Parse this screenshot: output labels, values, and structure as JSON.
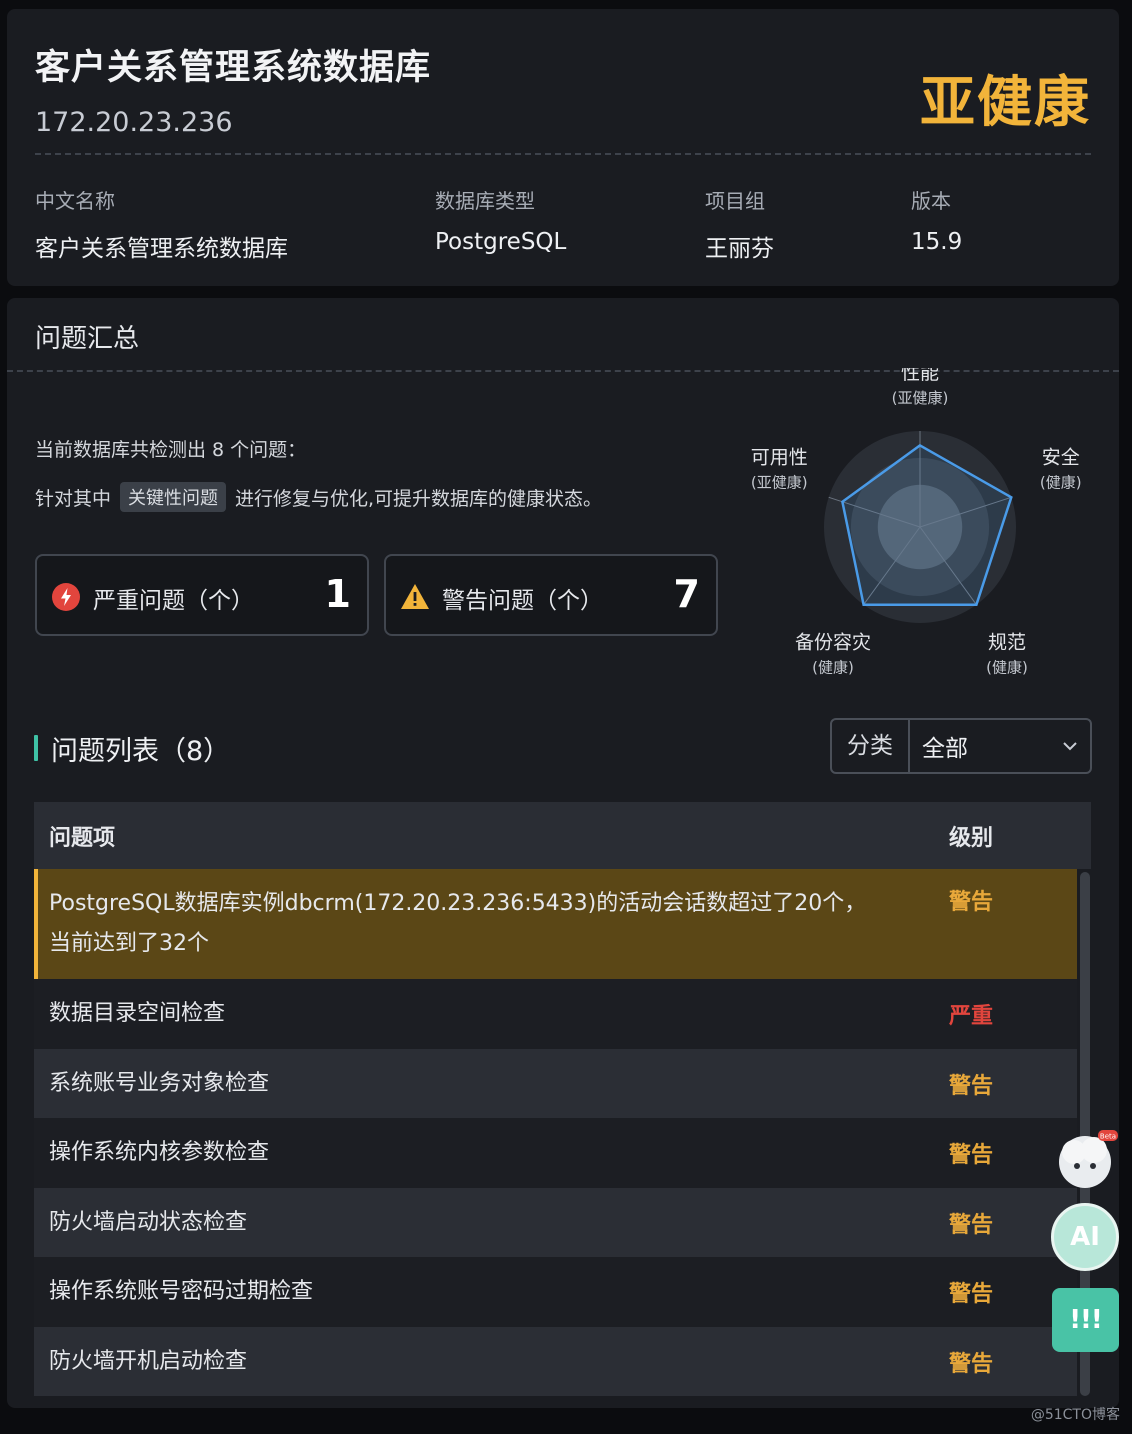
{
  "header": {
    "title": "客户关系管理系统数据库",
    "ip": "172.20.23.236",
    "health_status": "亚健康",
    "info": [
      {
        "label": "中文名称",
        "value": "客户关系管理系统数据库"
      },
      {
        "label": "数据库类型",
        "value": "PostgreSQL"
      },
      {
        "label": "项目组",
        "value": "王丽芬"
      },
      {
        "label": "版本",
        "value": "15.9"
      }
    ]
  },
  "summary": {
    "title": "问题汇总",
    "desc_line1": "当前数据库共检测出 8 个问题：",
    "desc_prefix": "针对其中",
    "desc_tag": "关键性问题",
    "desc_suffix": "进行修复与优化,可提升数据库的健康状态。",
    "critical": {
      "label": "严重问题（个）",
      "value": "1",
      "color": "#e2453d"
    },
    "warning": {
      "label": "警告问题（个）",
      "value": "7",
      "color": "#f2b43a"
    }
  },
  "radar": {
    "axes": [
      {
        "name": "性能",
        "status": "(亚健康)"
      },
      {
        "name": "安全",
        "status": "(健康)"
      },
      {
        "name": "规范",
        "status": "(健康)"
      },
      {
        "name": "备份容灾",
        "status": "(健康)"
      },
      {
        "name": "可用性",
        "status": "(亚健康)"
      }
    ],
    "values": [
      0.85,
      1.0,
      1.0,
      1.0,
      0.85
    ],
    "line_color": "#4a9be8"
  },
  "issues": {
    "title": "问题列表（8）",
    "filter_label": "分类",
    "filter_value": "全部",
    "col_item": "问题项",
    "col_level": "级别",
    "rows": [
      {
        "name": "PostgreSQL数据库实例dbcrm(172.20.23.236:5433)的活动会话数超过了20个，",
        "name2": "当前达到了32个",
        "level": "警告"
      },
      {
        "name": "数据目录空间检查",
        "level": "严重"
      },
      {
        "name": "系统账号业务对象检查",
        "level": "警告"
      },
      {
        "name": "操作系统内核参数检查",
        "level": "警告"
      },
      {
        "name": "防火墙启动状态检查",
        "level": "警告"
      },
      {
        "name": "操作系统账号密码过期检查",
        "level": "警告"
      },
      {
        "name": "防火墙开机启动检查",
        "level": "警告"
      }
    ]
  },
  "floating": {
    "ai_label": "AI",
    "feedback_label": "!!!",
    "beta_label": "Beta"
  },
  "watermark": "@51CTO博客"
}
